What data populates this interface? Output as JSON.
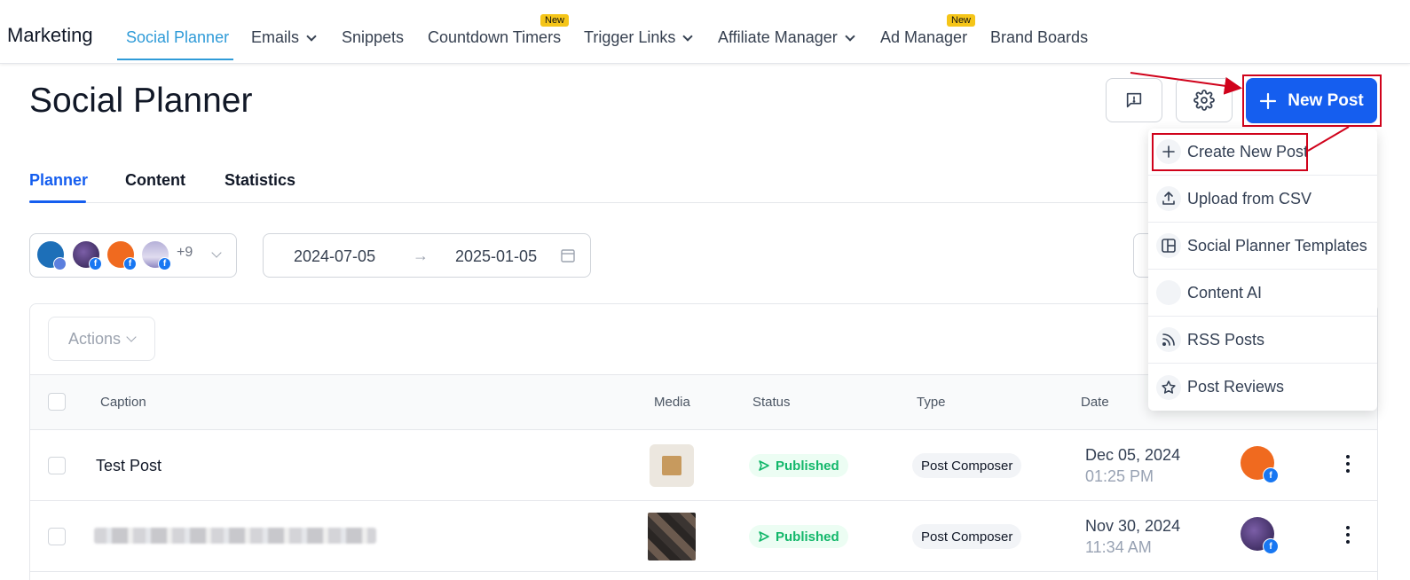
{
  "topnav": {
    "brand": "Marketing",
    "items": [
      {
        "label": "Social Planner",
        "active": true
      },
      {
        "label": "Emails",
        "dropdown": true
      },
      {
        "label": "Snippets"
      },
      {
        "label": "Countdown Timers",
        "badge": "New"
      },
      {
        "label": "Trigger Links",
        "dropdown": true
      },
      {
        "label": "Affiliate Manager",
        "dropdown": true
      },
      {
        "label": "Ad Manager",
        "badge": "New"
      },
      {
        "label": "Brand Boards"
      }
    ]
  },
  "header": {
    "title": "Social Planner",
    "feedback_icon": "feedback-icon",
    "settings_icon": "gear-icon",
    "new_post_label": "New Post"
  },
  "tabs": [
    {
      "label": "Planner",
      "active": true
    },
    {
      "label": "Content"
    },
    {
      "label": "Statistics"
    }
  ],
  "filters": {
    "accounts_more": "+9",
    "date_start": "2025-01-05",
    "date_from": "2024-07-05",
    "date_to": "2025-01-05",
    "date_arrow": "→"
  },
  "table": {
    "actions_label": "Actions",
    "columns": [
      "Caption",
      "Media",
      "Status",
      "Type",
      "Date"
    ],
    "rows": [
      {
        "caption": "Test Post",
        "status": "Published",
        "type": "Post Composer",
        "date": "Dec 05, 2024",
        "time": "01:25 PM"
      },
      {
        "caption": "",
        "status": "Published",
        "type": "Post Composer",
        "date": "Nov 30, 2024",
        "time": "11:34 AM"
      }
    ]
  },
  "dropdown": {
    "items": [
      {
        "label": "Create New Post",
        "icon": "plus-icon"
      },
      {
        "label": "Upload from CSV",
        "icon": "upload-icon"
      },
      {
        "label": "Social Planner Templates",
        "icon": "template-icon"
      },
      {
        "label": "Content AI",
        "icon": "ai-icon"
      },
      {
        "label": "RSS Posts",
        "icon": "rss-icon"
      },
      {
        "label": "Post Reviews",
        "icon": "star-icon"
      }
    ]
  },
  "colors": {
    "primary": "#155eef",
    "nav_active": "#2f9bd8",
    "published": "#12b76a",
    "annotation": "#d0021b",
    "badge": "#f5c518"
  }
}
